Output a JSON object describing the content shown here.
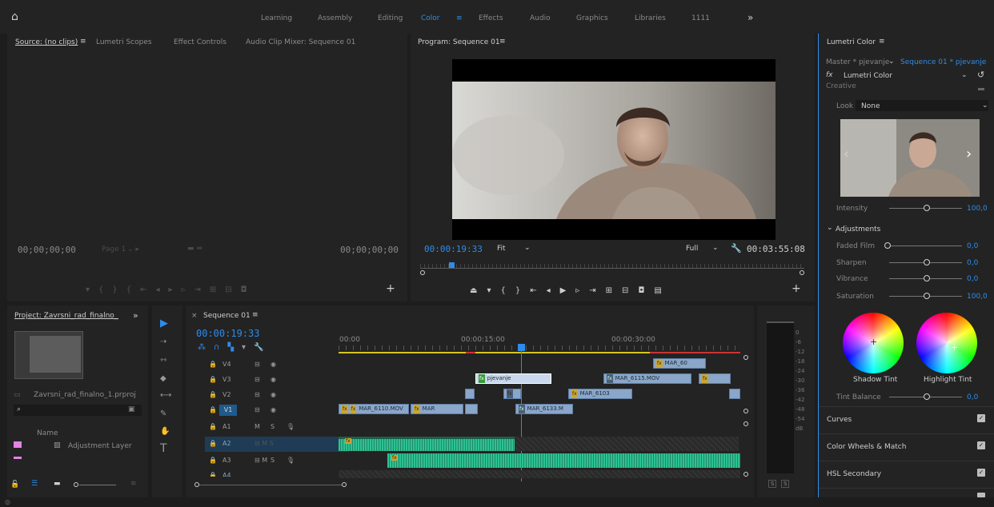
{
  "workspaces": {
    "tabs": [
      {
        "label": "Learning"
      },
      {
        "label": "Assembly"
      },
      {
        "label": "Editing"
      },
      {
        "label": "Color"
      },
      {
        "label": "Effects"
      },
      {
        "label": "Audio"
      },
      {
        "label": "Graphics"
      },
      {
        "label": "Libraries"
      },
      {
        "label": "1111"
      }
    ],
    "more": "»"
  },
  "source": {
    "tabs": [
      "Source: (no clips)",
      "Lumetri Scopes",
      "Effect Controls",
      "Audio Clip Mixer: Sequence 01"
    ],
    "tc_left": "00;00;00;00",
    "page": "Page 1",
    "tc_right": "00;00;00;00"
  },
  "program": {
    "title": "Program: Sequence 01",
    "timecode": "00:00:19:33",
    "fit": "Fit",
    "quality": "Full",
    "duration": "00:03:55:08"
  },
  "project": {
    "title": "Project: Zavrsni_rad_finalno_1",
    "file": "Zavrsni_rad_finalno_1.prproj",
    "col_name": "Name",
    "item1": "Adjustment Layer"
  },
  "timeline": {
    "tab": "Sequence 01",
    "timecode": "00:00:19:33",
    "ruler": [
      "00:00",
      "00:00:15:00",
      "00:00:30:00"
    ],
    "tracks": [
      "V4",
      "V3",
      "V2",
      "V1",
      "A1",
      "A2",
      "A3",
      "A4"
    ],
    "clips": {
      "mar60": "MAR_60",
      "pjevanje": "pjevanje",
      "mar6115": "MAR_6115.MOV",
      "mar6103": "MAR_6103",
      "mar6110": "MAR_6110.MOV",
      "mar": "MAR",
      "mar6133": "MAR_6133.M"
    },
    "meter_db": [
      "0",
      "-6",
      "-12",
      "-18",
      "-24",
      "-30",
      "-36",
      "-42",
      "-48",
      "-54",
      "dB"
    ],
    "solo": "S"
  },
  "lumetri": {
    "title": "Lumetri Color",
    "master": "Master * pjevanje",
    "sequence": "Sequence 01 * pjevanje",
    "effect": "Lumetri Color",
    "creative": "Creative",
    "look_label": "Look",
    "look_value": "None",
    "intensity_label": "Intensity",
    "intensity_value": "100,0",
    "adjustments": "Adjustments",
    "faded_label": "Faded Film",
    "faded_value": "0,0",
    "sharpen_label": "Sharpen",
    "sharpen_value": "0,0",
    "vibrance_label": "Vibrance",
    "vibrance_value": "0,0",
    "saturation_label": "Saturation",
    "saturation_value": "100,0",
    "shadow_tint": "Shadow Tint",
    "highlight_tint": "Highlight Tint",
    "tint_balance_label": "Tint Balance",
    "tint_balance_value": "0,0",
    "sections": [
      "Curves",
      "Color Wheels & Match",
      "HSL Secondary"
    ]
  },
  "colors": {
    "accent": "#2d8ceb",
    "clip_video": "#8aa6c8",
    "clip_audio": "#2fc192"
  }
}
